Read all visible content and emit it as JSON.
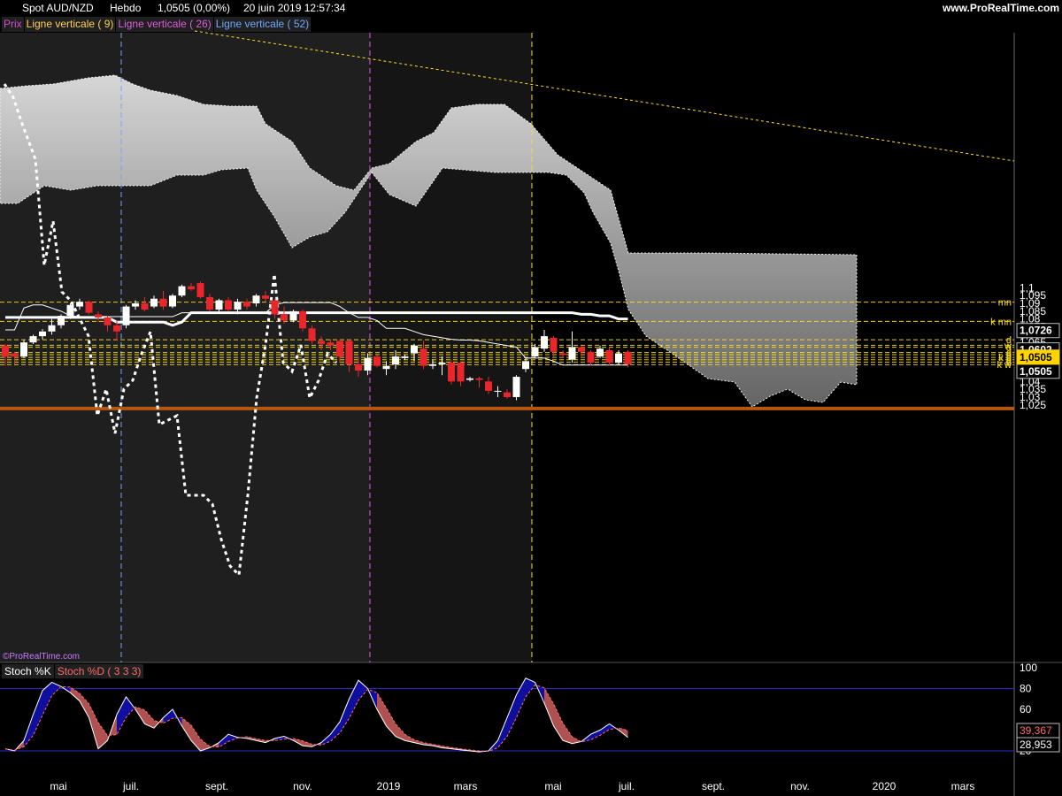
{
  "header": {
    "instrument": "Spot AUD/NZD",
    "period": "Hebdo",
    "price": "1,0505 (0,00%)",
    "timestamp": "20 juin 2019 12:57:34",
    "site": "www.ProRealTime.com"
  },
  "legend": [
    {
      "label": "Prix",
      "color": "#d24bd2"
    },
    {
      "label": "Ligne verticale ( 9)",
      "color": "#ffd24b"
    },
    {
      "label": "Ligne verticale ( 26)",
      "color": "#e05be0"
    },
    {
      "label": "Ligne verticale ( 52)",
      "color": "#6fa8ff"
    }
  ],
  "watermark": "©ProRealTime.com",
  "stoch_legend": [
    {
      "label": "Stoch %K",
      "color": "#ffffff"
    },
    {
      "label": "Stoch %D ( 3 3 3)",
      "color": "#ff6b6b"
    }
  ],
  "colors": {
    "up_candle": "#ffffff",
    "down_candle": "#e8262b",
    "level_line": "#ffe11a",
    "support": "#b8560f",
    "cloud": "#c8c8c8",
    "kumo_line": "#ffffff",
    "stoch_blue": "#1010b0",
    "stoch_red": "#c25a5a"
  },
  "chart_data": [
    {
      "type": "candlestick",
      "title": "Spot AUD/NZD Hebdo",
      "ylim": [
        1.02,
        1.105
      ],
      "y_ticks": [
        "1,1",
        "1,095",
        "1,09",
        "1,085",
        "1,08",
        "1,075",
        "1,07",
        "1,065",
        "1,06",
        "1,055",
        "1,05",
        "1,045",
        "1,04",
        "1,035",
        "1,03",
        "1,025"
      ],
      "x_labels": [
        "mai",
        "juil.",
        "sept.",
        "nov.",
        "2019",
        "mars",
        "mai",
        "juil.",
        "sept.",
        "nov.",
        "2020",
        "mars"
      ],
      "price_tags": [
        {
          "label": "1,0726",
          "value": 1.0726
        },
        {
          "label": "1,0602",
          "value": 1.0602
        },
        {
          "label": "1,0554",
          "value": 1.0554
        },
        {
          "label": "1,0505",
          "value": 1.0505
        },
        {
          "label": "1,0505",
          "value": 1.0505,
          "current": true
        }
      ],
      "levels": [
        {
          "label": "mn",
          "value": 1.0908
        },
        {
          "label": "k mn",
          "value": 1.0785
        },
        {
          "label": "d",
          "value": 1.0667
        },
        {
          "label": "w",
          "value": 1.0632
        },
        {
          "label": "d",
          "value": 1.0619
        },
        {
          "label": "d",
          "value": 1.0585
        },
        {
          "label": "d",
          "value": 1.0572
        },
        {
          "label": "k d",
          "value": 1.0554
        },
        {
          "label": "d",
          "value": 1.0539
        },
        {
          "label": "d",
          "value": 1.0524
        },
        {
          "label": "k w",
          "value": 1.0508
        }
      ],
      "support_line": 1.0227,
      "candles": [
        [
          1.063,
          1.056,
          1.064,
          1.05
        ],
        [
          1.058,
          1.056,
          1.059,
          1.051
        ],
        [
          1.056,
          1.065,
          1.0665,
          1.055
        ],
        [
          1.065,
          1.069,
          1.07,
          1.064
        ],
        [
          1.069,
          1.072,
          1.0735,
          1.067
        ],
        [
          1.072,
          1.076,
          1.08,
          1.07
        ],
        [
          1.076,
          1.082,
          1.083,
          1.074
        ],
        [
          1.082,
          1.089,
          1.09,
          1.08
        ],
        [
          1.088,
          1.091,
          1.093,
          1.086
        ],
        [
          1.091,
          1.084,
          1.092,
          1.083
        ],
        [
          1.083,
          1.081,
          1.085,
          1.078
        ],
        [
          1.081,
          1.076,
          1.082,
          1.072
        ],
        [
          1.076,
          1.072,
          1.079,
          1.066
        ],
        [
          1.076,
          1.088,
          1.089,
          1.074
        ],
        [
          1.088,
          1.09,
          1.092,
          1.086
        ],
        [
          1.09,
          1.086,
          1.094,
          1.085
        ],
        [
          1.088,
          1.093,
          1.095,
          1.087
        ],
        [
          1.093,
          1.088,
          1.098,
          1.086
        ],
        [
          1.088,
          1.095,
          1.096,
          1.087
        ],
        [
          1.095,
          1.101,
          1.102,
          1.094
        ],
        [
          1.101,
          1.099,
          1.103,
          1.098
        ],
        [
          1.103,
          1.094,
          1.104,
          1.093
        ],
        [
          1.094,
          1.086,
          1.096,
          1.085
        ],
        [
          1.086,
          1.092,
          1.093,
          1.084
        ],
        [
          1.092,
          1.086,
          1.094,
          1.085
        ],
        [
          1.086,
          1.091,
          1.093,
          1.083
        ],
        [
          1.091,
          1.088,
          1.093,
          1.086
        ],
        [
          1.09,
          1.095,
          1.096,
          1.088
        ],
        [
          1.095,
          1.093,
          1.098,
          1.091
        ],
        [
          1.092,
          1.083,
          1.093,
          1.08
        ],
        [
          1.083,
          1.079,
          1.088,
          1.077
        ],
        [
          1.079,
          1.085,
          1.086,
          1.078
        ],
        [
          1.085,
          1.074,
          1.086,
          1.072
        ],
        [
          1.074,
          1.066,
          1.076,
          1.064
        ],
        [
          1.066,
          1.064,
          1.069,
          1.06
        ],
        [
          1.065,
          1.063,
          1.067,
          1.06
        ],
        [
          1.066,
          1.056,
          1.067,
          1.052
        ],
        [
          1.066,
          1.051,
          1.067,
          1.046
        ],
        [
          1.051,
          1.047,
          1.056,
          1.043
        ],
        [
          1.047,
          1.055,
          1.058,
          1.044
        ],
        [
          1.056,
          1.05,
          1.057,
          1.049
        ],
        [
          1.048,
          1.05,
          1.053,
          1.044
        ],
        [
          1.051,
          1.056,
          1.06,
          1.048
        ],
        [
          1.055,
          1.056,
          1.057,
          1.054
        ],
        [
          1.058,
          1.063,
          1.064,
          1.053
        ],
        [
          1.061,
          1.05,
          1.066,
          1.048
        ],
        [
          1.05,
          1.051,
          1.054,
          1.048
        ],
        [
          1.051,
          1.052,
          1.056,
          1.044
        ],
        [
          1.052,
          1.04,
          1.054,
          1.038
        ],
        [
          1.052,
          1.04,
          1.053,
          1.037
        ],
        [
          1.041,
          1.042,
          1.043,
          1.04
        ],
        [
          1.042,
          1.041,
          1.043,
          1.036
        ],
        [
          1.04,
          1.034,
          1.043,
          1.032
        ],
        [
          1.034,
          1.034,
          1.037,
          1.03
        ],
        [
          1.033,
          1.03,
          1.035,
          1.029
        ],
        [
          1.03,
          1.043,
          1.044,
          1.028
        ],
        [
          1.048,
          1.053,
          1.055,
          1.046
        ],
        [
          1.056,
          1.062,
          1.064,
          1.055
        ],
        [
          1.061,
          1.069,
          1.073,
          1.059
        ],
        [
          1.068,
          1.059,
          1.069,
          1.056
        ],
        [
          1.058,
          1.057,
          1.06,
          1.055
        ],
        [
          1.054,
          1.062,
          1.072,
          1.052
        ],
        [
          1.062,
          1.059,
          1.063,
          1.056
        ],
        [
          1.059,
          1.052,
          1.06,
          1.05
        ],
        [
          1.056,
          1.061,
          1.063,
          1.055
        ],
        [
          1.06,
          1.052,
          1.062,
          1.05
        ],
        [
          1.052,
          1.058,
          1.06,
          1.051
        ],
        [
          1.059,
          1.051,
          1.06,
          1.049
        ]
      ],
      "tenkan": [
        1.073,
        1.073,
        1.087,
        1.089,
        1.089,
        1.087,
        1.085,
        1.082,
        1.0815,
        1.0815,
        1.0815,
        1.0815,
        1.0815,
        1.0815,
        1.0815,
        1.0815,
        1.0815,
        1.0815,
        1.0815,
        1.084,
        1.084,
        1.084,
        1.084,
        1.084,
        1.084,
        1.084,
        1.084,
        1.084,
        1.084,
        1.089,
        1.0905,
        1.0905,
        1.0905,
        1.0905,
        1.0905,
        1.0905,
        1.088,
        1.084,
        1.081,
        1.081,
        1.079,
        1.074,
        1.074,
        1.074,
        1.072,
        1.07,
        1.069,
        1.068,
        1.067,
        1.0665,
        1.0665,
        1.066,
        1.065,
        1.064,
        1.063,
        1.062,
        1.055,
        1.055,
        1.055,
        1.053,
        1.0505,
        1.0505,
        1.0505,
        1.0505,
        1.0505,
        1.0505,
        1.0505,
        1.0505
      ],
      "kijun": [
        1.081,
        1.081,
        1.081,
        1.081,
        1.081,
        1.081,
        1.081,
        1.081,
        1.081,
        1.081,
        1.081,
        1.081,
        1.078,
        1.078,
        1.078,
        1.078,
        1.078,
        1.078,
        1.076,
        1.078,
        1.084,
        1.084,
        1.084,
        1.084,
        1.084,
        1.084,
        1.084,
        1.084,
        1.084,
        1.084,
        1.084,
        1.084,
        1.084,
        1.084,
        1.084,
        1.084,
        1.084,
        1.084,
        1.084,
        1.084,
        1.084,
        1.084,
        1.084,
        1.084,
        1.084,
        1.084,
        1.084,
        1.084,
        1.084,
        1.084,
        1.084,
        1.084,
        1.084,
        1.084,
        1.084,
        1.084,
        1.084,
        1.084,
        1.084,
        1.084,
        1.084,
        1.084,
        1.083,
        1.083,
        1.082,
        1.082,
        1.08,
        1.08
      ],
      "stoch_k": [
        22,
        20,
        30,
        55,
        78,
        86,
        82,
        76,
        68,
        52,
        22,
        30,
        55,
        72,
        60,
        46,
        42,
        52,
        60,
        44,
        30,
        20,
        23,
        28,
        36,
        33,
        32,
        30,
        28,
        32,
        34,
        30,
        25,
        24,
        28,
        36,
        48,
        70,
        88,
        80,
        60,
        44,
        34,
        30,
        28,
        26,
        25,
        23,
        22,
        21,
        20,
        19,
        20,
        30,
        52,
        74,
        90,
        86,
        66,
        44,
        30,
        27,
        29,
        36,
        40,
        46,
        40,
        33
      ]
    },
    {
      "type": "line",
      "title": "Stoch %K / Stoch %D ( 3 3 3)",
      "ylim": [
        14,
        100
      ],
      "y_ticks": [
        "100",
        "80",
        "60",
        "40",
        "20"
      ],
      "levels": [
        20,
        80
      ],
      "last_values": [
        {
          "label": "39,367",
          "series": "Stoch %D",
          "value": 39.367
        },
        {
          "label": "28,953",
          "series": "Stoch %K",
          "value": 28.953
        }
      ]
    }
  ]
}
